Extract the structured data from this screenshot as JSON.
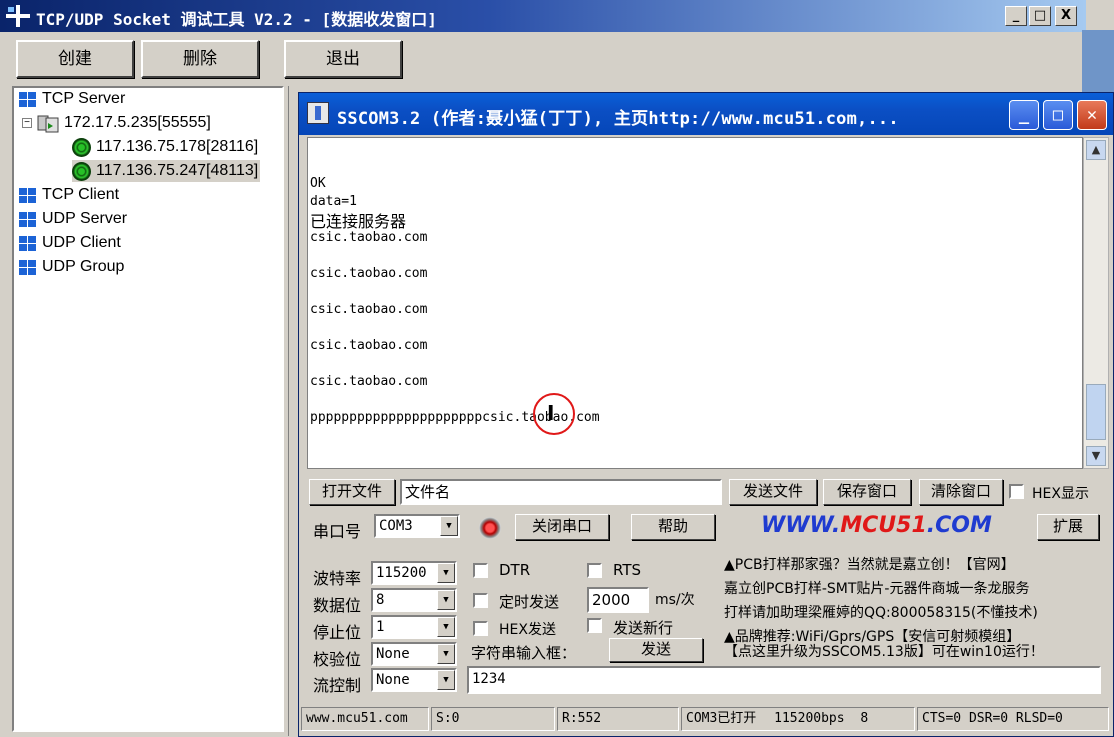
{
  "back_window": {
    "title": "TCP/UDP Socket 调试工具 V2.2 - [数据收发窗口]",
    "caption_buttons": [
      "_",
      "□",
      "X"
    ],
    "toolbar": [
      "创建",
      "删除",
      "退出"
    ],
    "tree": {
      "tcp_server": "TCP Server",
      "server_node": "172.17.5.235[55555]",
      "clients": [
        "117.136.75.178[28116]",
        "117.136.75.247[48113]"
      ],
      "tcp_client": "TCP Client",
      "udp_server": "UDP Server",
      "udp_client": "UDP Client",
      "udp_group": "UDP Group"
    }
  },
  "sscom": {
    "title": "SSCOM3.2 (作者:聂小猛(丁丁), 主页http://www.mcu51.com,...",
    "receive_lines": [
      "OK",
      "data=1",
      "已连接服务器",
      "csic.taobao.com",
      "",
      "csic.taobao.com",
      "",
      "csic.taobao.com",
      "",
      "csic.taobao.com",
      "",
      "csic.taobao.com",
      "",
      "ppppppppppppppppppppppcsic.taobao.com"
    ],
    "file_row": {
      "open_file": "打开文件",
      "file_name": "文件名",
      "send_file": "发送文件",
      "save_window": "保存窗口",
      "clear_window": "清除窗口",
      "hex_display": "HEX显示"
    },
    "port_row": {
      "port_label": "串口号",
      "port_value": "COM3",
      "close_port": "关闭串口",
      "help": "帮助",
      "link_prefix": "WWW.",
      "link_brand": "MCU51",
      "link_suffix": ".COM",
      "expand": "扩展"
    },
    "settings": {
      "baud_label": "波特率",
      "baud": "115200",
      "databits_label": "数据位",
      "databits": "8",
      "stopbits_label": "停止位",
      "stopbits": "1",
      "parity_label": "校验位",
      "parity": "None",
      "flow_label": "流控制",
      "flow": "None"
    },
    "options": {
      "dtr": "DTR",
      "rts": "RTS",
      "timed_send": "定时发送",
      "interval": "2000",
      "interval_unit": "ms/次",
      "hex_send": "HEX发送",
      "send_newline": "发送新行",
      "input_label": "字符串输入框：",
      "send_button": "发送",
      "input_value": "1234"
    },
    "ads": [
      "▲PCB打样那家强？当然就是嘉立创！【官网】",
      "嘉立创PCB打样-SMT贴片-元器件商城一条龙服务",
      "打样请加助理梁雁婷的QQ:800058315(不懂技术)",
      "▲品牌推荐:WiFi/Gprs/GPS【安信可射频模组】",
      "【点这里升级为SSCOM5.13版】可在win10运行！"
    ],
    "status": {
      "site": "www.mcu51.com",
      "sent": "S:0",
      "received": "R:552",
      "port_state": "COM3已打开",
      "baud_info": "115200bps",
      "bits": "8",
      "lines": "CTS=0 DSR=0 RLSD=0"
    }
  }
}
